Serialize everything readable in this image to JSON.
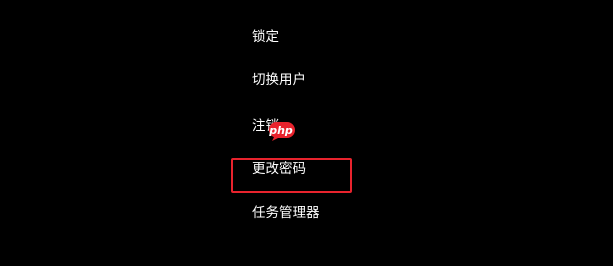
{
  "menu": {
    "items": [
      {
        "label": "锁定"
      },
      {
        "label": "切换用户"
      },
      {
        "label": "注销"
      },
      {
        "label": "更改密码"
      },
      {
        "label": "任务管理器"
      }
    ]
  },
  "highlight": {
    "target": "更改密码",
    "color": "#e8232d"
  },
  "watermark": {
    "text": "php",
    "color": "#e8232d"
  },
  "colors": {
    "background": "#000000",
    "text": "#ffffff"
  }
}
